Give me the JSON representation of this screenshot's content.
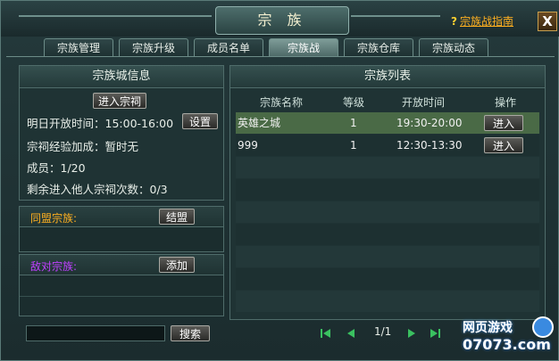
{
  "window": {
    "title": "宗 族",
    "guide_link": "宗族战指南",
    "guide_icon": "question-mark-icon",
    "close_label": "X"
  },
  "tabs": [
    {
      "label": "宗族管理",
      "active": false
    },
    {
      "label": "宗族升级",
      "active": false
    },
    {
      "label": "成员名单",
      "active": false
    },
    {
      "label": "宗族战",
      "active": true
    },
    {
      "label": "宗族仓库",
      "active": false
    },
    {
      "label": "宗族动态",
      "active": false
    }
  ],
  "city_info": {
    "title": "宗族城信息",
    "enter_button": "进入宗祠",
    "open_time_label": "明日开放时间：15:00-16:00",
    "settings_button": "设置",
    "exp_bonus": "宗祠经验加成：暂时无",
    "members": "成员：1/20",
    "remaining_visits": "剩余进入他人宗祠次数：0/3"
  },
  "alliance": {
    "label": "同盟宗族:",
    "button": "结盟",
    "label_color": "#ffb020"
  },
  "enemy": {
    "label": "敌对宗族:",
    "button": "添加",
    "label_color": "#c040ff"
  },
  "search": {
    "value": "",
    "button": "搜索"
  },
  "clan_list": {
    "title": "宗族列表",
    "columns": [
      "宗族名称",
      "等级",
      "开放时间",
      "操作"
    ],
    "rows": [
      {
        "name": "英雄之城",
        "level": "1",
        "time": "19:30-20:00",
        "action": "进入",
        "selected": true
      },
      {
        "name": "999",
        "level": "1",
        "time": "12:30-13:30",
        "action": "进入",
        "selected": false
      }
    ]
  },
  "pager": {
    "page": "1/1",
    "first_icon": "first-page-icon",
    "prev_icon": "prev-page-icon",
    "next_icon": "next-page-icon",
    "last_icon": "last-page-icon",
    "accent": "#3ac060"
  },
  "watermark": {
    "line1": "网页游戏",
    "line2": "07073.com"
  }
}
